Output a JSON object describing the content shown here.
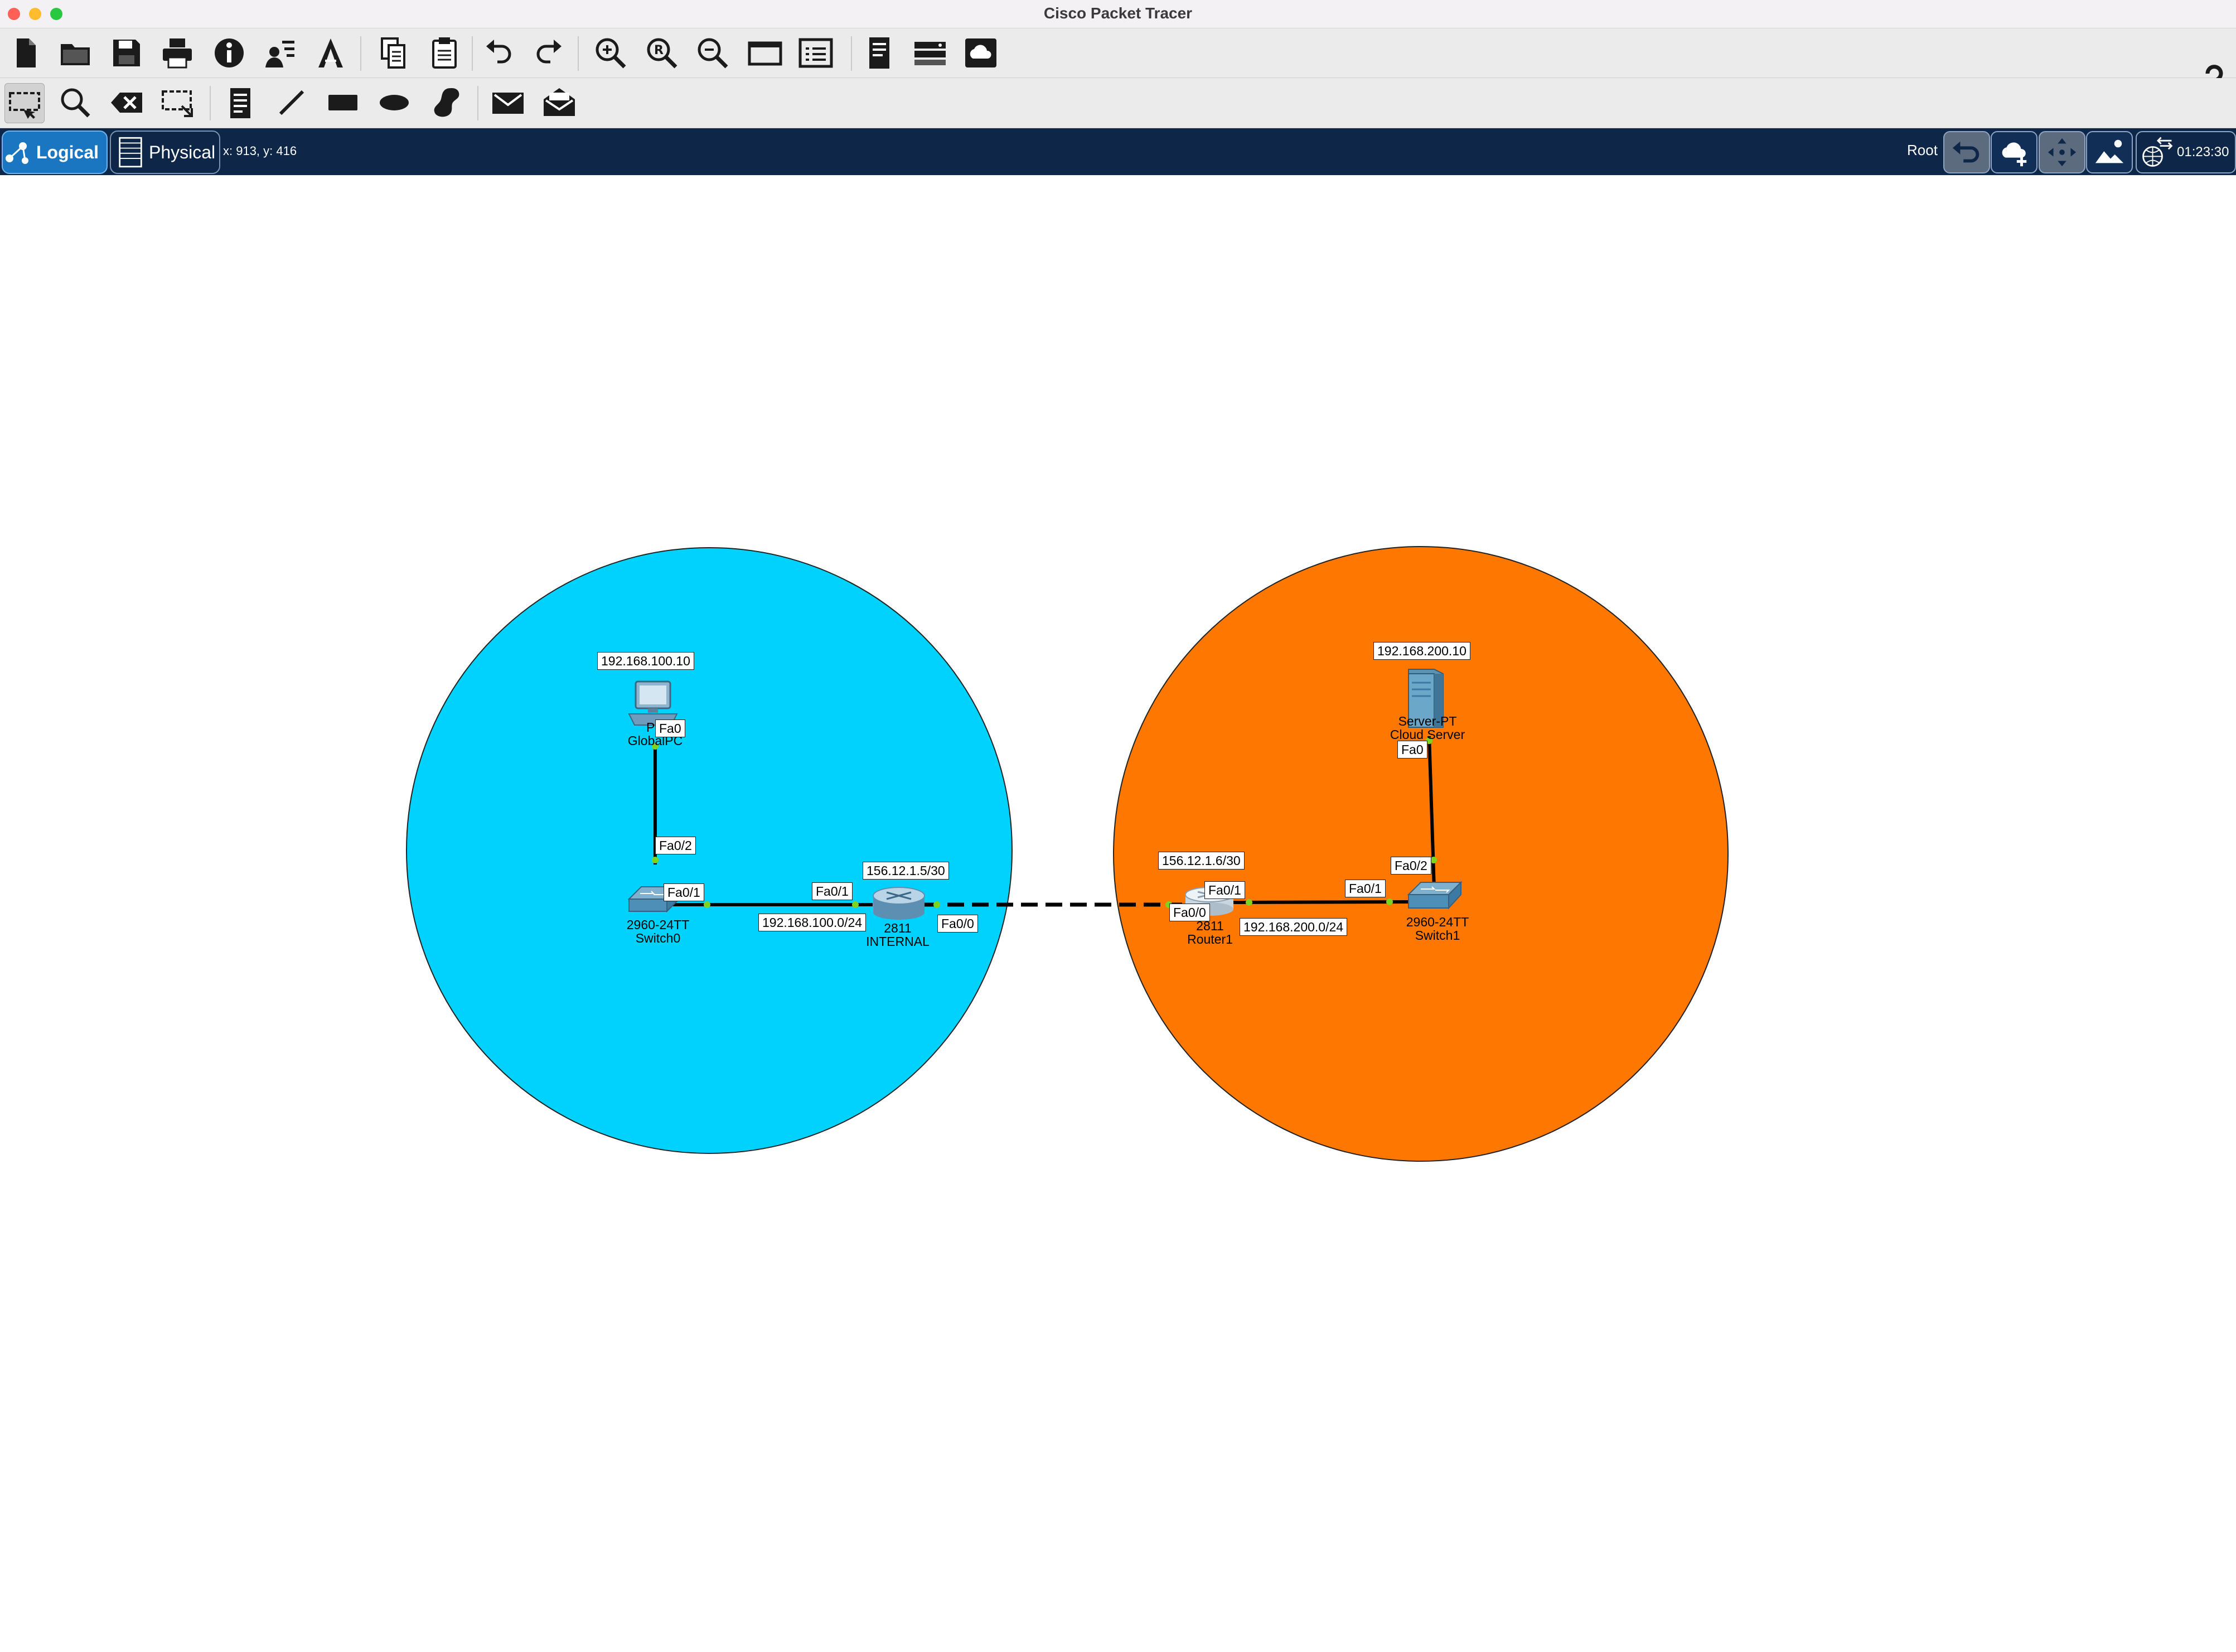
{
  "window": {
    "title": "Cisco Packet Tracer",
    "traffic_colors": {
      "close": "#fe5f57",
      "minimize": "#febc2e",
      "zoom": "#28c840"
    }
  },
  "toolbar_main": {
    "icons": [
      "new-file-icon",
      "open-folder-icon",
      "save-icon",
      "print-icon",
      "info-icon",
      "activity-wizard-icon",
      "network-info-icon",
      "copy-icon",
      "paste-icon",
      "undo-icon",
      "redo-icon",
      "zoom-in-icon",
      "zoom-reset-icon",
      "zoom-out-icon",
      "drawing-palette-icon",
      "custom-device-dialog-icon",
      "pdu-list-icon",
      "device-tray-icon",
      "cloud-view-icon"
    ],
    "help_icon": "help-icon"
  },
  "toolbar_tools": {
    "icons": [
      "select-icon",
      "inspect-icon",
      "delete-icon",
      "resize-shape-icon",
      "note-icon",
      "line-icon",
      "rectangle-icon",
      "ellipse-icon",
      "freeform-icon",
      "simple-pdu-icon",
      "complex-pdu-icon"
    ]
  },
  "logical_bar": {
    "logical_label": "Logical",
    "physical_label": "Physical",
    "coordinates": "x: 913, y: 416",
    "root_label": "Root",
    "clock": "01:23:30",
    "colors": {
      "background": "#0e2748",
      "active": "#1a76c1"
    }
  },
  "topology": {
    "zones": [
      {
        "name": "internal-zone",
        "color": "#00d2fe"
      },
      {
        "name": "cloud-zone",
        "color": "#fe7700"
      }
    ],
    "devices": {
      "pc": {
        "model": "PC",
        "name": "GlobalPC",
        "ip": "192.168.100.10",
        "port": "Fa0"
      },
      "switch0": {
        "model": "2960-24TT",
        "name": "Switch0",
        "ports": [
          "Fa0/2",
          "Fa0/1"
        ]
      },
      "internal_router": {
        "model": "2811",
        "name": "INTERNAL",
        "ports": [
          "Fa0/1",
          "Fa0/0"
        ],
        "wan_ip": "156.12.1.5/30"
      },
      "router1": {
        "model": "2811",
        "name": "Router1",
        "ports": [
          "Fa0/0",
          "Fa0/1"
        ],
        "wan_ip": "156.12.1.6/30"
      },
      "switch1": {
        "model": "2960-24TT",
        "name": "Switch1",
        "ports": [
          "Fa0/2",
          "Fa0/1"
        ]
      },
      "server": {
        "model": "Server-PT",
        "name": "Cloud Server",
        "ip": "192.168.200.10",
        "port": "Fa0"
      }
    },
    "networks": {
      "left_lan": "192.168.100.0/24",
      "right_lan": "192.168.200.0/24"
    },
    "link_light_color": "#7ed321"
  }
}
